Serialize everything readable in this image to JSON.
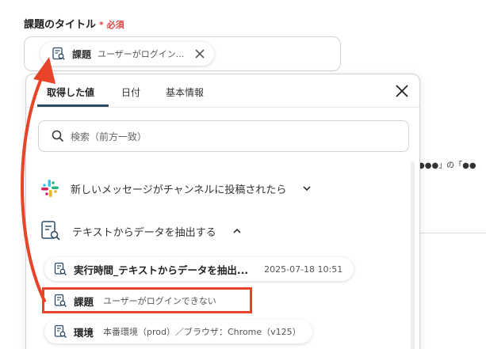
{
  "field": {
    "label": "課題のタイトル",
    "required_mark": "*",
    "required_text": "必須"
  },
  "input_chip": {
    "name": "課題",
    "value": "ユーザーがログイン..."
  },
  "bg_snippet": "●●●」の「●●",
  "tabs": [
    {
      "label": "取得した値",
      "active": true
    },
    {
      "label": "日付",
      "active": false
    },
    {
      "label": "基本情報",
      "active": false
    }
  ],
  "search": {
    "placeholder": "検索（前方一致）"
  },
  "sections": [
    {
      "label": "新しいメッセージがチャンネルに投稿されたら",
      "icon": "slack-icon",
      "expanded": false
    },
    {
      "label": "テキストからデータを抽出する",
      "icon": "document-search-icon",
      "expanded": true
    }
  ],
  "items": [
    {
      "name": "実行時間_テキストからデータを抽出...",
      "value": "",
      "timestamp": "2025-07-18 10:51"
    },
    {
      "name": "課題",
      "value": "ユーザーがログインできない",
      "timestamp": "",
      "highlighted": true
    },
    {
      "name": "環境",
      "value": "本番環境（prod）／ブラウザ：Chrome（v125）",
      "timestamp": ""
    }
  ],
  "colors": {
    "accent": "#e8442a",
    "required": "#e04646",
    "tab_underline": "#2e4a63"
  }
}
